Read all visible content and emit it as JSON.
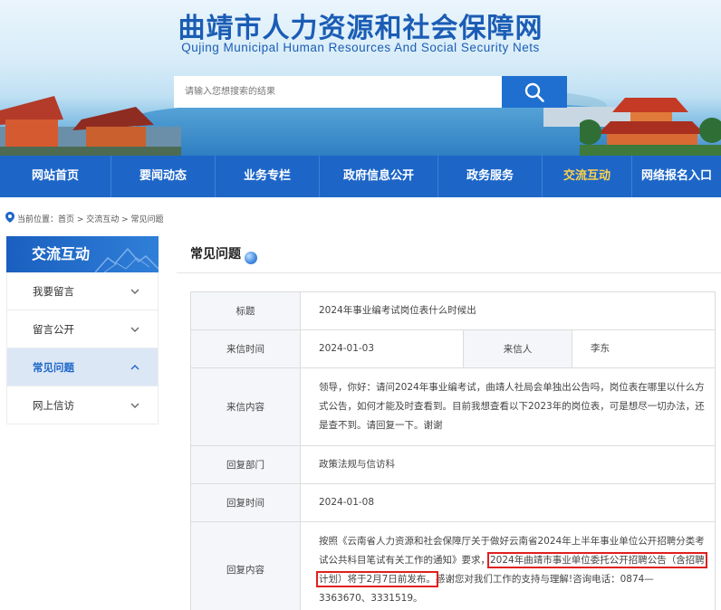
{
  "site": {
    "title": "曲靖市人力资源和社会保障网",
    "subtitle": "Qujing Municipal Human Resources And Social Security Nets"
  },
  "search": {
    "placeholder": "请输入您想搜索的结果",
    "icon": "search-icon"
  },
  "nav": {
    "items": [
      "网站首页",
      "要闻动态",
      "业务专栏",
      "政府信息公开",
      "政务服务",
      "交流互动",
      "网络报名入口"
    ],
    "active": "交流互动"
  },
  "breadcrumb": {
    "prefix": "当前位置：",
    "path": "首页 > 交流互动 > 常见问题"
  },
  "sidebar": {
    "title": "交流互动",
    "items": [
      {
        "label": "我要留言",
        "chevron": "chevron-down-icon"
      },
      {
        "label": "留言公开",
        "chevron": "chevron-down-icon"
      },
      {
        "label": "常见问题",
        "chevron": "chevron-up-icon"
      },
      {
        "label": "网上信访",
        "chevron": "chevron-down-icon"
      }
    ]
  },
  "main": {
    "title": "常见问题",
    "rows": {
      "title_label": "标题",
      "title_value": "2024年事业编考试岗位表什么时候出",
      "date_label": "来信时间",
      "date_value": "2024-01-03",
      "sender_label": "来信人",
      "sender_value": "李东",
      "content_label": "来信内容",
      "content_value": "领导，你好：请问2024年事业编考试，曲靖人社局会单独出公告吗，岗位表在哪里以什么方式公告，如何才能及时查看到。目前我想查看以下2023年的岗位表，可是想尽一切办法，还是查不到。请回复一下。谢谢",
      "dept_label": "回复部门",
      "dept_value": "政策法规与信访科",
      "reply_date_label": "回复时间",
      "reply_date_value": "2024-01-08",
      "reply_label": "回复内容",
      "reply_part1": "按照《云南省人力资源和社会保障厅关于做好云南省2024年上半年事业单位公开招聘分类考试公共科目笔试有关工作的通知》要求，",
      "reply_highlight": "2024年曲靖市事业单位委托公开招聘公告（含招聘计划）将于2月7日前发布。",
      "reply_part2": "感谢您对我们工作的支持与理解!咨询电话：0874—3363670、3331519。"
    }
  },
  "colors": {
    "brand_blue": "#1d66c8",
    "nav_active": "#ffd24a",
    "highlight": "#e02020"
  }
}
